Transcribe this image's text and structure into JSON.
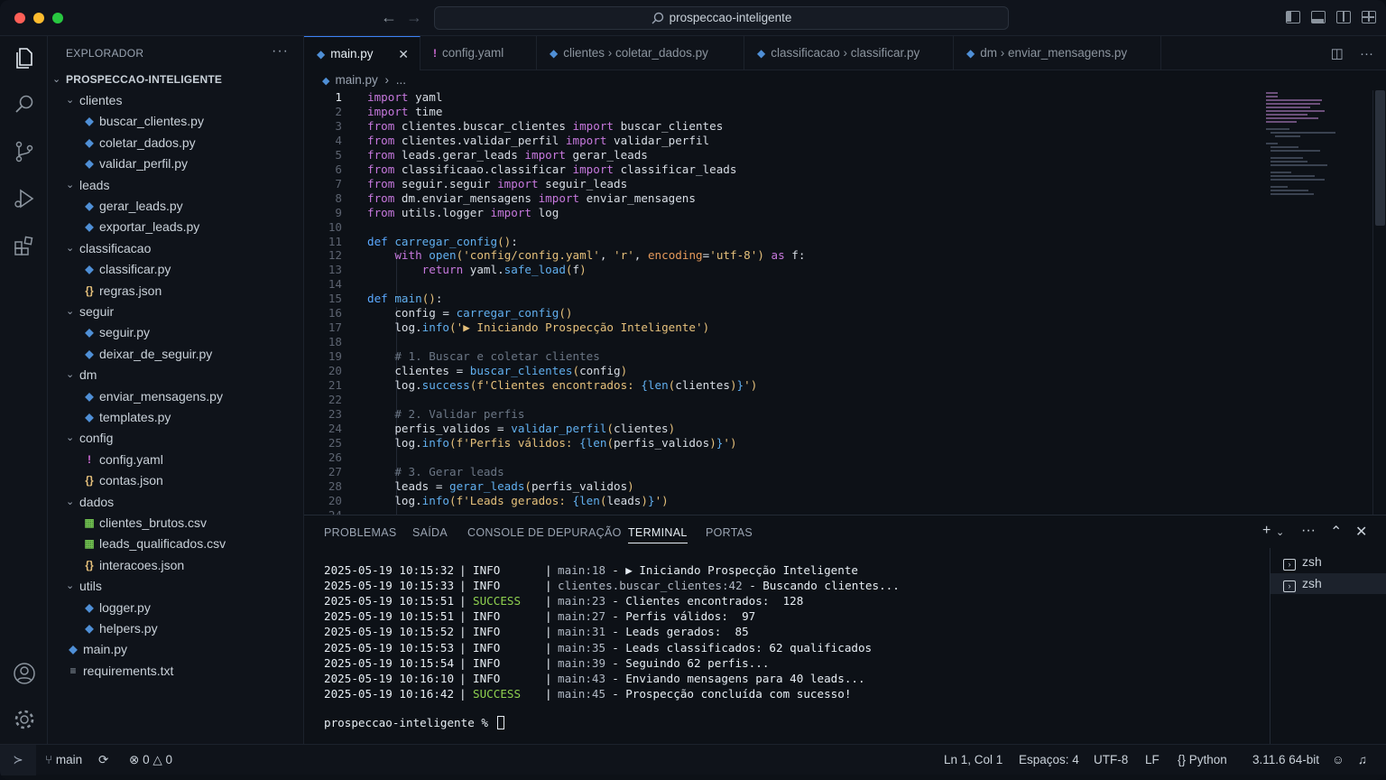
{
  "titlebar": {
    "search_text": "prospeccao-inteligente",
    "back_icon": "arrow-left-icon",
    "forward_icon": "arrow-right-icon"
  },
  "explorer": {
    "title": "EXPLORADOR",
    "more": "···",
    "root": "PROSPECCAO-INTELIGENTE",
    "tree": [
      {
        "label": "clientes",
        "type": "folder",
        "depth": 1
      },
      {
        "label": "buscar_clientes.py",
        "type": "py",
        "depth": 2
      },
      {
        "label": "coletar_dados.py",
        "type": "py",
        "depth": 2
      },
      {
        "label": "validar_perfil.py",
        "type": "py",
        "depth": 2
      },
      {
        "label": "leads",
        "type": "folder",
        "depth": 1
      },
      {
        "label": "gerar_leads.py",
        "type": "py",
        "depth": 2
      },
      {
        "label": "exportar_leads.py",
        "type": "py",
        "depth": 2
      },
      {
        "label": "classificacao",
        "type": "folder",
        "depth": 1
      },
      {
        "label": "classificar.py",
        "type": "py",
        "depth": 2
      },
      {
        "label": "regras.json",
        "type": "json",
        "depth": 2
      },
      {
        "label": "seguir",
        "type": "folder",
        "depth": 1
      },
      {
        "label": "seguir.py",
        "type": "py",
        "depth": 2
      },
      {
        "label": "deixar_de_seguir.py",
        "type": "py",
        "depth": 2
      },
      {
        "label": "dm",
        "type": "folder",
        "depth": 1
      },
      {
        "label": "enviar_mensagens.py",
        "type": "py",
        "depth": 2
      },
      {
        "label": "templates.py",
        "type": "py",
        "depth": 2
      },
      {
        "label": "config",
        "type": "folder",
        "depth": 1
      },
      {
        "label": "config.yaml",
        "type": "yaml",
        "depth": 2
      },
      {
        "label": "contas.json",
        "type": "json",
        "depth": 2
      },
      {
        "label": "dados",
        "type": "folder",
        "depth": 1
      },
      {
        "label": "clientes_brutos.csv",
        "type": "csv",
        "depth": 2
      },
      {
        "label": "leads_qualificados.csv",
        "type": "csv",
        "depth": 2
      },
      {
        "label": "interacoes.json",
        "type": "json",
        "depth": 2
      },
      {
        "label": "utils",
        "type": "folder",
        "depth": 1
      },
      {
        "label": "logger.py",
        "type": "py",
        "depth": 2
      },
      {
        "label": "helpers.py",
        "type": "py",
        "depth": 2
      },
      {
        "label": "main.py",
        "type": "py",
        "depth": 1
      },
      {
        "label": "requirements.txt",
        "type": "txt",
        "depth": 1
      }
    ]
  },
  "tabs": [
    {
      "label": "main.py",
      "icon": "python-icon",
      "active": true,
      "prefix": ""
    },
    {
      "label": "config.yaml",
      "icon": "yaml-icon",
      "active": false,
      "prefix": ""
    },
    {
      "label": "coletar_dados.py",
      "icon": "python-icon",
      "active": false,
      "prefix": "clientes"
    },
    {
      "label": "classificar.py",
      "icon": "python-icon",
      "active": false,
      "prefix": "classificacao"
    },
    {
      "label": "enviar_mensagens.py",
      "icon": "python-icon",
      "active": false,
      "prefix": "dm"
    }
  ],
  "breadcrumb": {
    "file": "main.py",
    "rest": "..."
  },
  "code": [
    [
      [
        "kw",
        "import"
      ],
      [
        "t",
        " yaml"
      ]
    ],
    [
      [
        "kw",
        "import"
      ],
      [
        "t",
        " time"
      ]
    ],
    [
      [
        "kw",
        "from"
      ],
      [
        "t",
        " clientes.buscar_clientes "
      ],
      [
        "kw",
        "import"
      ],
      [
        "t",
        " buscar_clientes"
      ]
    ],
    [
      [
        "kw",
        "from"
      ],
      [
        "t",
        " clientes.validar_perfil "
      ],
      [
        "kw",
        "import"
      ],
      [
        "t",
        " validar_perfil"
      ]
    ],
    [
      [
        "kw",
        "from"
      ],
      [
        "t",
        " leads.gerar_leads "
      ],
      [
        "kw",
        "import"
      ],
      [
        "t",
        " gerar_leads"
      ]
    ],
    [
      [
        "kw",
        "from"
      ],
      [
        "t",
        " classificaao.classificar "
      ],
      [
        "kw",
        "import"
      ],
      [
        "t",
        " classificar_leads"
      ]
    ],
    [
      [
        "kw",
        "from"
      ],
      [
        "t",
        " seguir.seguir "
      ],
      [
        "kw",
        "import"
      ],
      [
        "t",
        " seguir_leads"
      ]
    ],
    [
      [
        "kw",
        "from"
      ],
      [
        "t",
        " dm.enviar_mensagens "
      ],
      [
        "kw",
        "import"
      ],
      [
        "t",
        " enviar_mensagens"
      ]
    ],
    [
      [
        "kw",
        "from"
      ],
      [
        "t",
        " utils.logger "
      ],
      [
        "kw",
        "import"
      ],
      [
        "t",
        " log"
      ]
    ],
    [],
    [
      [
        "kw2",
        "def"
      ],
      [
        "t",
        " "
      ],
      [
        "fn",
        "carregar_config"
      ],
      [
        "str",
        "()"
      ],
      [
        "t",
        ":"
      ]
    ],
    [
      [
        "t",
        "    "
      ],
      [
        "kw",
        "with"
      ],
      [
        "t",
        " "
      ],
      [
        "fn",
        "open"
      ],
      [
        "str",
        "("
      ],
      [
        "str",
        "'config/config.yaml'"
      ],
      [
        "t",
        ", "
      ],
      [
        "str",
        "'r'"
      ],
      [
        "t",
        ", "
      ],
      [
        "param",
        "encoding"
      ],
      [
        "t",
        "="
      ],
      [
        "str",
        "'utf-8'"
      ],
      [
        "str",
        ")"
      ],
      [
        "t",
        " "
      ],
      [
        "kw",
        "as"
      ],
      [
        "t",
        " f:"
      ]
    ],
    [
      [
        "t",
        "        "
      ],
      [
        "kw",
        "return"
      ],
      [
        "t",
        " yaml."
      ],
      [
        "fn",
        "safe_load"
      ],
      [
        "str",
        "("
      ],
      [
        "t",
        "f"
      ],
      [
        "str",
        ")"
      ]
    ],
    [],
    [
      [
        "kw2",
        "def"
      ],
      [
        "t",
        " "
      ],
      [
        "fn",
        "main"
      ],
      [
        "str",
        "()"
      ],
      [
        "t",
        ":"
      ]
    ],
    [
      [
        "t",
        "    config = "
      ],
      [
        "fn",
        "carregar_config"
      ],
      [
        "str",
        "()"
      ]
    ],
    [
      [
        "t",
        "    log."
      ],
      [
        "fn",
        "info"
      ],
      [
        "str",
        "("
      ],
      [
        "str",
        "'▶ Iniciando Prospecção Inteligente'"
      ],
      [
        "str",
        ")"
      ]
    ],
    [],
    [
      [
        "t",
        "    "
      ],
      [
        "cm",
        "# 1. Buscar e coletar clientes"
      ]
    ],
    [
      [
        "t",
        "    clientes = "
      ],
      [
        "fn",
        "buscar_clientes"
      ],
      [
        "str",
        "("
      ],
      [
        "t",
        "config"
      ],
      [
        "str",
        ")"
      ]
    ],
    [
      [
        "t",
        "    log."
      ],
      [
        "fn",
        "success"
      ],
      [
        "str",
        "("
      ],
      [
        "str",
        "f'Clientes encontrados: "
      ],
      [
        "fn",
        "{len"
      ],
      [
        "str",
        "("
      ],
      [
        "t",
        "clientes"
      ],
      [
        "str",
        ")"
      ],
      [
        "fn",
        "}"
      ],
      [
        "str",
        "'"
      ],
      [
        "str",
        ")"
      ]
    ],
    [],
    [
      [
        "t",
        "    "
      ],
      [
        "cm",
        "# 2. Validar perfis"
      ]
    ],
    [
      [
        "t",
        "    perfis_validos = "
      ],
      [
        "fn",
        "validar_perfil"
      ],
      [
        "str",
        "("
      ],
      [
        "t",
        "clientes"
      ],
      [
        "str",
        ")"
      ]
    ],
    [
      [
        "t",
        "    log."
      ],
      [
        "fn",
        "info"
      ],
      [
        "str",
        "("
      ],
      [
        "str",
        "f'Perfis válidos: "
      ],
      [
        "fn",
        "{len"
      ],
      [
        "str",
        "("
      ],
      [
        "t",
        "perfis_validos"
      ],
      [
        "str",
        ")"
      ],
      [
        "fn",
        "}"
      ],
      [
        "str",
        "'"
      ],
      [
        "str",
        ")"
      ]
    ],
    [],
    [
      [
        "t",
        "    "
      ],
      [
        "cm",
        "# 3. Gerar leads"
      ]
    ],
    [
      [
        "t",
        "    leads = "
      ],
      [
        "fn",
        "gerar_leads"
      ],
      [
        "str",
        "("
      ],
      [
        "t",
        "perfis_validos"
      ],
      [
        "str",
        ")"
      ]
    ],
    [
      [
        "t",
        "    log."
      ],
      [
        "fn",
        "info"
      ],
      [
        "str",
        "("
      ],
      [
        "str",
        "f'Leads gerados: "
      ],
      [
        "fn",
        "{len"
      ],
      [
        "str",
        "("
      ],
      [
        "t",
        "leads"
      ],
      [
        "str",
        ")"
      ],
      [
        "fn",
        "}"
      ],
      [
        "str",
        "'"
      ],
      [
        "str",
        ")"
      ]
    ]
  ],
  "line_numbers": [
    "1",
    "2",
    "3",
    "4",
    "5",
    "6",
    "7",
    "8",
    "9",
    "10",
    "11",
    "12",
    "13",
    "14",
    "15",
    "16",
    "17",
    "18",
    "19",
    "20",
    "21",
    "22",
    "23",
    "24",
    "25",
    "26",
    "27",
    "28",
    "20",
    "24"
  ],
  "panel": {
    "tabs": [
      "PROBLEMAS",
      "SAÍDA",
      "CONSOLE DE DEPURAÇÃO",
      "TERMINAL",
      "PORTAS"
    ],
    "active_tab": "TERMINAL",
    "log": [
      {
        "ts": "2025-05-19 10:15:32",
        "level": "INFO",
        "loc": "main:18",
        "msg": "▶ Iniciando Prospecção Inteligente"
      },
      {
        "ts": "2025-05-19 10:15:33",
        "level": "INFO",
        "loc": "clientes.buscar_clientes:42",
        "msg": "Buscando clientes..."
      },
      {
        "ts": "2025-05-19 10:15:51",
        "level": "SUCCESS",
        "loc": "main:23",
        "msg": "Clientes encontrados:  128"
      },
      {
        "ts": "2025-05-19 10:15:51",
        "level": "INFO",
        "loc": "main:27",
        "msg": "Perfis válidos:  97"
      },
      {
        "ts": "2025-05-19 10:15:52",
        "level": "INFO",
        "loc": "main:31",
        "msg": "Leads gerados:  85"
      },
      {
        "ts": "2025-05-19 10:15:53",
        "level": "INFO",
        "loc": "main:35",
        "msg": "Leads classificados: 62 qualificados"
      },
      {
        "ts": "2025-05-19 10:15:54",
        "level": "INFO",
        "loc": "main:39",
        "msg": "Seguindo 62 perfis..."
      },
      {
        "ts": "2025-05-19 10:16:10",
        "level": "INFO",
        "loc": "main:43",
        "msg": "Enviando mensagens para 40 leads..."
      },
      {
        "ts": "2025-05-19 10:16:42",
        "level": "SUCCESS",
        "loc": "main:45",
        "msg": "Prospecção concluída com sucesso!"
      }
    ],
    "prompt": "prospeccao-inteligente % ",
    "terminals": [
      "zsh",
      "zsh"
    ]
  },
  "statusbar": {
    "branch": "main",
    "errors": "0",
    "warnings": "0",
    "position": "Ln 1, Col 1",
    "spaces": "Espaços: 4",
    "encoding": "UTF-8",
    "eol": "LF",
    "language": "Python",
    "interpreter": "3.11.6 64-bit"
  },
  "colors": {
    "accent": "#3b82f6",
    "success": "#8fd14f",
    "keyword": "#c678dd",
    "function": "#61afef",
    "string": "#e5c07b"
  }
}
